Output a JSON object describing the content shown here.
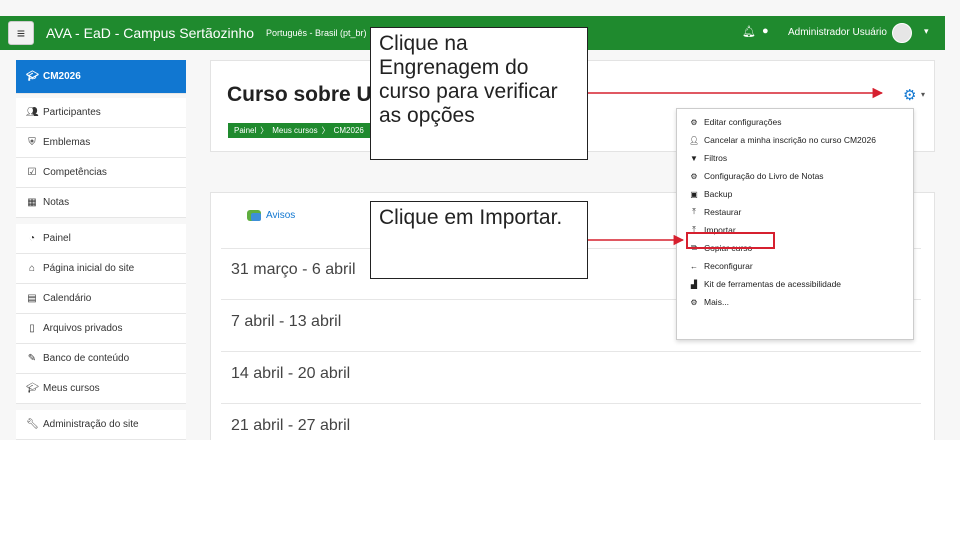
{
  "topbar": {
    "menu_icon": "hamburger-icon",
    "site_name": "AVA - EaD - Campus Sertãozinho",
    "language": "Português - Brasil (pt_br)",
    "notification_icon": "bell-icon",
    "message_icon": "chat-icon",
    "user_name": "Administrador Usuário",
    "brand_color": "#1f8a2e"
  },
  "sidebar": {
    "items": [
      {
        "label": "CM2026",
        "icon": "graduation-cap-icon",
        "active": true
      },
      {
        "label": "Participantes",
        "icon": "users-icon"
      },
      {
        "label": "Emblemas",
        "icon": "shield-icon"
      },
      {
        "label": "Competências",
        "icon": "checkbox-icon"
      },
      {
        "label": "Notas",
        "icon": "table-icon"
      },
      {
        "label": "Painel",
        "icon": "dashboard-icon"
      },
      {
        "label": "Página inicial do site",
        "icon": "home-icon"
      },
      {
        "label": "Calendário",
        "icon": "calendar-icon"
      },
      {
        "label": "Arquivos privados",
        "icon": "file-icon"
      },
      {
        "label": "Banco de conteúdo",
        "icon": "brush-icon"
      },
      {
        "label": "Meus cursos",
        "icon": "graduation-cap-icon"
      },
      {
        "label": "Administração do site",
        "icon": "wrench-icon"
      }
    ],
    "active_color": "#1177d1"
  },
  "header": {
    "course_title": "Curso sobre Utilização do Moodle",
    "breadcrumb": [
      "Painel",
      "Meus cursos",
      "CM2026"
    ],
    "settings_icon": "gear-icon"
  },
  "content": {
    "announcements": "Avisos",
    "weeks": [
      "31 março - 6 abril",
      "7 abril - 13 abril",
      "14 abril - 20 abril",
      "21 abril - 27 abril"
    ]
  },
  "menu": {
    "items": [
      {
        "label": "Editar configurações",
        "icon": "gear-icon"
      },
      {
        "label": "Cancelar a minha inscrição no curso CM2026",
        "icon": "user-icon"
      },
      {
        "label": "Filtros",
        "icon": "filter-icon"
      },
      {
        "label": "Configuração do Livro de Notas",
        "icon": "gear-icon"
      },
      {
        "label": "Backup",
        "icon": "save-icon"
      },
      {
        "label": "Restaurar",
        "icon": "upload-icon"
      },
      {
        "label": "Importar",
        "icon": "upload-icon",
        "highlighted": true
      },
      {
        "label": "Copiar curso",
        "icon": "copy-icon"
      },
      {
        "label": "Reconfigurar",
        "icon": "arrow-left-icon"
      },
      {
        "label": "Kit de ferramentas de acessibilidade",
        "icon": "chart-icon"
      },
      {
        "label": "Mais...",
        "icon": "gear-icon"
      }
    ]
  },
  "annotations": {
    "callout_gear": "Clique na Engrenagem do curso para verificar as opções",
    "callout_import": "Clique em Importar.",
    "highlight_color": "#d6202f"
  }
}
